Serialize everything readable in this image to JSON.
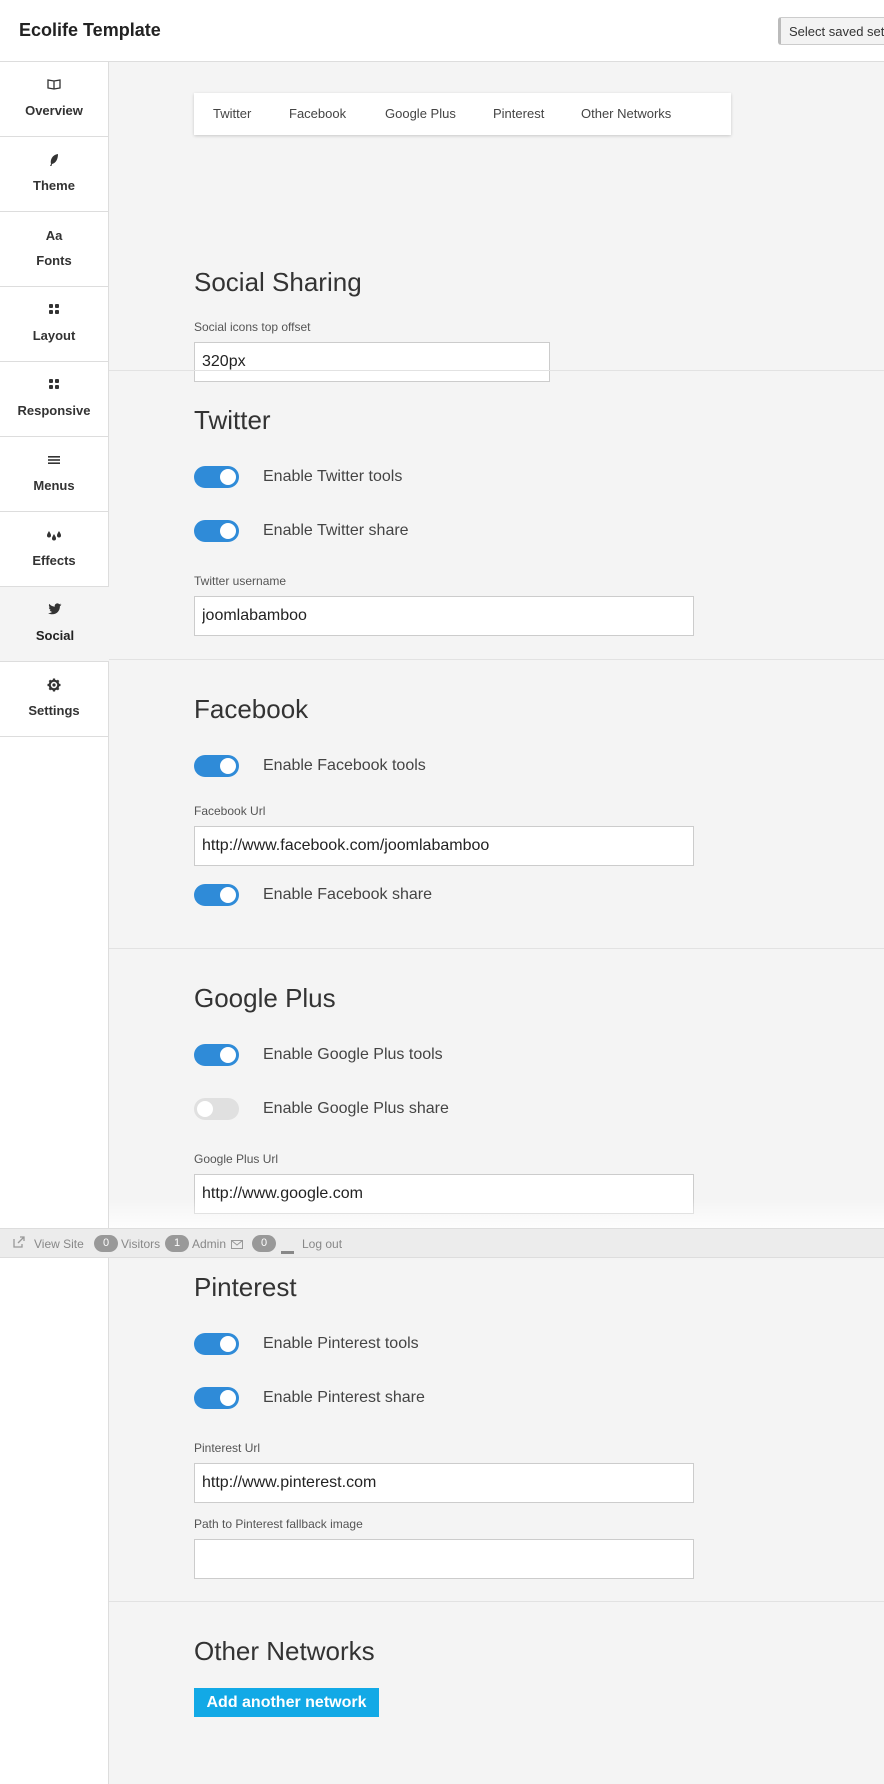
{
  "app": {
    "title": "Ecolife Template",
    "saved_settings_label": "Select saved settings"
  },
  "sidebar": {
    "items": [
      {
        "label": "Overview",
        "icon": "book-icon"
      },
      {
        "label": "Theme",
        "icon": "feather-icon"
      },
      {
        "label": "Fonts",
        "icon": "font-icon"
      },
      {
        "label": "Layout",
        "icon": "grid-icon"
      },
      {
        "label": "Responsive",
        "icon": "grid-icon"
      },
      {
        "label": "Menus",
        "icon": "menu-icon"
      },
      {
        "label": "Effects",
        "icon": "drops-icon"
      },
      {
        "label": "Social",
        "icon": "twitter-icon",
        "active": true
      },
      {
        "label": "Settings",
        "icon": "gear-icon"
      }
    ]
  },
  "tabs": [
    "Twitter",
    "Facebook",
    "Google Plus",
    "Pinterest",
    "Other Networks"
  ],
  "social_sharing": {
    "title": "Social Sharing",
    "offset_label": "Social icons top offset",
    "offset_value": "320px"
  },
  "twitter": {
    "title": "Twitter",
    "tools_label": "Enable Twitter tools",
    "tools_on": true,
    "share_label": "Enable Twitter share",
    "share_on": true,
    "username_label": "Twitter username",
    "username_value": "joomlabamboo"
  },
  "facebook": {
    "title": "Facebook",
    "tools_label": "Enable Facebook tools",
    "tools_on": true,
    "url_label": "Facebook Url",
    "url_value": "http://www.facebook.com/joomlabamboo",
    "share_label": "Enable Facebook share",
    "share_on": true
  },
  "google_plus": {
    "title": "Google Plus",
    "tools_label": "Enable Google Plus tools",
    "tools_on": true,
    "share_label": "Enable Google Plus share",
    "share_on": false,
    "url_label": "Google Plus Url",
    "url_value": "http://www.google.com"
  },
  "pinterest": {
    "title": "Pinterest",
    "tools_label": "Enable Pinterest tools",
    "tools_on": true,
    "share_label": "Enable Pinterest share",
    "share_on": true,
    "url_label": "Pinterest Url",
    "url_value": "http://www.pinterest.com",
    "fallback_label": "Path to Pinterest fallback image",
    "fallback_value": ""
  },
  "other_networks": {
    "title": "Other Networks",
    "add_button": "Add another network"
  },
  "statusbar": {
    "view_site": "View Site",
    "visitors_count": "0",
    "visitors_label": "Visitors",
    "admin_count": "1",
    "admin_label": "Admin",
    "messages_count": "0",
    "logout": "Log out"
  },
  "colors": {
    "accent": "#2f8bd8",
    "button": "#12a9e6",
    "toggle_off": "#e0e0e0"
  }
}
